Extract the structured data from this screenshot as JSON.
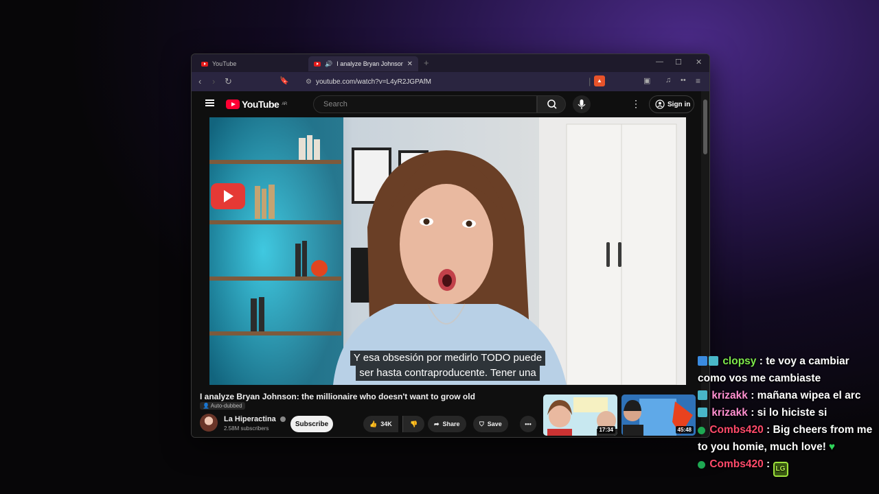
{
  "browser": {
    "tabs": [
      {
        "title": "YouTube",
        "active": false
      },
      {
        "title": "I analyze Bryan Johnson: the m",
        "active": true
      }
    ],
    "url": "youtube.com/watch?v=L4yR2JGPAfM",
    "accent": "#2a2540"
  },
  "youtube": {
    "logo_text": "YouTube",
    "region": "AR",
    "search_placeholder": "Search",
    "sign_in": "Sign in",
    "captions": [
      "Y esa obsesión por medirlo TODO puede",
      "ser hasta contraproducente. Tener una"
    ],
    "video_title": "I analyze Bryan Johnson: the millionaire who doesn't want to grow old",
    "auto_dubbed": "Auto-dubbed",
    "channel_name": "La Hiperactina",
    "subscribers": "2.58M subscribers",
    "subscribe": "Subscribe",
    "likes": "34K",
    "share": "Share",
    "save": "Save",
    "related": [
      {
        "duration": "17:34",
        "overlay_text": "Mariano Barbacid\n\"cura el cáncer\nde páncreas\""
      },
      {
        "duration": "45:48",
        "overlay_text": "Es impos"
      }
    ]
  },
  "chat": [
    {
      "user": "clopsy",
      "color": "#7ee84b",
      "badges": [
        "prime",
        "sub"
      ],
      "text": "te voy a cambiar como vos me cambiaste"
    },
    {
      "user": "krizakk",
      "color": "#ff8fd0",
      "badges": [
        "sub"
      ],
      "text": "mañana wipea el arc"
    },
    {
      "user": "krizakk",
      "color": "#ff8fd0",
      "badges": [
        "sub"
      ],
      "text": "si lo hiciste si"
    },
    {
      "user": "Combs420",
      "color": "#ff4a6a",
      "badges": [
        "check"
      ],
      "text": "Big cheers from me to you homie, much love!"
    },
    {
      "user": "Combs420",
      "color": "#ff4a6a",
      "badges": [
        "check"
      ],
      "text": "",
      "emote": "LG"
    }
  ]
}
